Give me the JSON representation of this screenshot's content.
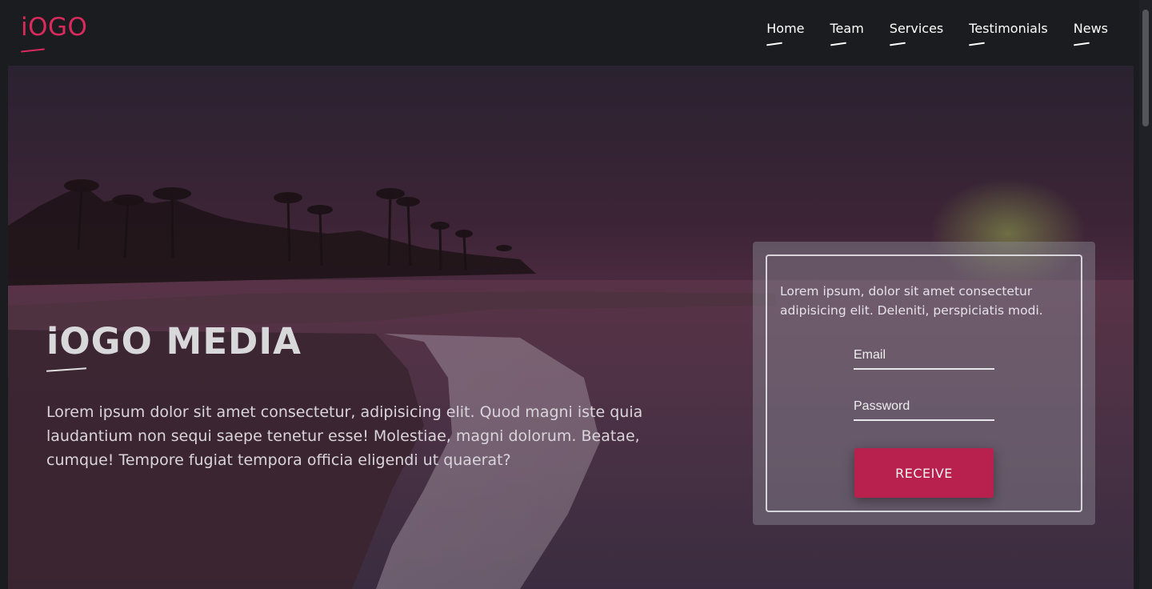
{
  "brand": {
    "logo_text": "iOGO",
    "accent_color": "#d92a5c"
  },
  "nav": {
    "items": [
      {
        "label": "Home"
      },
      {
        "label": "Team"
      },
      {
        "label": "Services"
      },
      {
        "label": "Testimonials"
      },
      {
        "label": "News"
      }
    ]
  },
  "hero": {
    "title": "iOGO MEDIA",
    "text": "Lorem ipsum dolor sit amet consectetur, adipisicing elit. Quod magni iste quia laudantium non sequi saepe tenetur esse! Molestiae, magni dolorum. Beatae, cumque! Tempore fugiat tempora officia eligendi ut quaerat?"
  },
  "form": {
    "text": "Lorem ipsum, dolor sit amet consectetur adipisicing elit. Deleniti, perspiciatis modi.",
    "email_placeholder": "Email",
    "password_placeholder": "Password",
    "submit_label": "RECEIVE",
    "button_color": "#b8204e"
  }
}
